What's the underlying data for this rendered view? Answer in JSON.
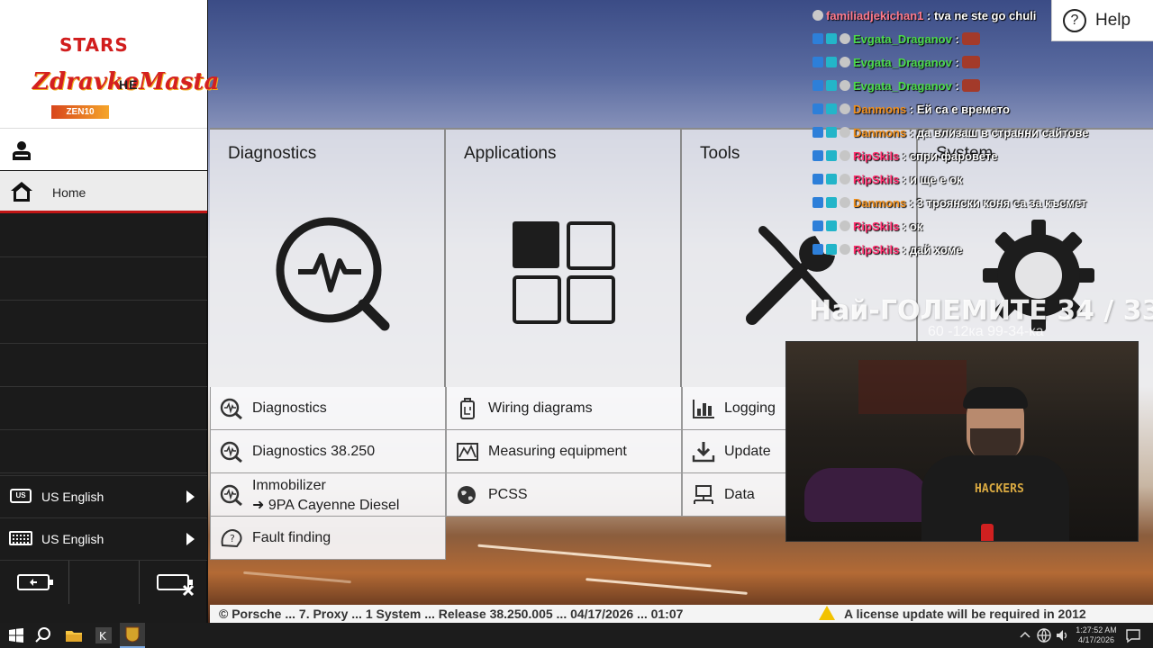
{
  "logo": {
    "top": "STARS",
    "name": "ZdravkoMasta",
    "overlay": "HE",
    "ribbon": "ZEN10"
  },
  "sidebar": {
    "home_label": "Home",
    "language_label": "US English",
    "language_badge": "US",
    "keyboard_label": "US English"
  },
  "categories": [
    {
      "title": "Diagnostics",
      "icon": "diagnostics-magnifier-icon"
    },
    {
      "title": "Applications",
      "icon": "apps-grid-icon"
    },
    {
      "title": "Tools",
      "icon": "wrench-screwdriver-icon"
    },
    {
      "title": "System",
      "icon": "gear-icon"
    }
  ],
  "diagnostics_items": [
    {
      "label": "Diagnostics"
    },
    {
      "label": "Diagnostics 38.250"
    },
    {
      "label_line1": "Immobilizer",
      "label_line2": "➜ 9PA Cayenne Diesel"
    },
    {
      "label": "Fault finding"
    }
  ],
  "applications_items": [
    {
      "label": "Wiring diagrams"
    },
    {
      "label": "Measuring equipment"
    },
    {
      "label": "PCSS"
    }
  ],
  "tools_items": [
    {
      "label": "Logging"
    },
    {
      "label": "Update"
    },
    {
      "label": "Data"
    }
  ],
  "help": {
    "label": "Help",
    "icon_glyph": "?"
  },
  "chat": [
    {
      "user": "familiadjekichan1",
      "text": ": tva ne ste go chuli",
      "color": "#ff7a8c"
    },
    {
      "user": "Evgata_Draganov",
      "text": ":",
      "color": "#4cd94c",
      "emote": true
    },
    {
      "user": "Evgata_Draganov",
      "text": ":",
      "color": "#4cd94c",
      "emote": true
    },
    {
      "user": "Evgata_Draganov",
      "text": ":",
      "color": "#4cd94c",
      "emote": true
    },
    {
      "user": "Danmons",
      "text": ": Ей са е времето",
      "color": "#f0901e"
    },
    {
      "user": "Danmons",
      "text": ": да влизаш в странни сайтове",
      "color": "#f0901e"
    },
    {
      "user": "RipSkils",
      "text": ": спри фаровете",
      "color": "#ff2f6e"
    },
    {
      "user": "RipSkils",
      "text": ": и ще е ок",
      "color": "#ff2f6e"
    },
    {
      "user": "Danmons",
      "text": ": 3 троянски коня са за късмет",
      "color": "#f0901e"
    },
    {
      "user": "RipSkils",
      "text": ": ок",
      "color": "#ff2f6e"
    },
    {
      "user": "RipSkils",
      "text": ": дай хоме",
      "color": "#ff2f6e"
    }
  ],
  "counter": {
    "title": "Най-ГОЛЕМИТЕ 34 / 33",
    "subtitle": "60 -12ка 99-34-ка"
  },
  "webcam": {
    "shirt_text": "HACKERS"
  },
  "status": {
    "left": "© Porsche ... 7. Proxy ... 1 System ... Release 38.250.005 ... 04/17/2026 ... 01:07",
    "right": "A license update will be required in 2012"
  },
  "taskbar": {
    "time": "1:27:52 AM",
    "date": "4/17/2026"
  },
  "colors": {
    "accent_red": "#c01515",
    "sidebar_bg": "#1b1b1b"
  }
}
